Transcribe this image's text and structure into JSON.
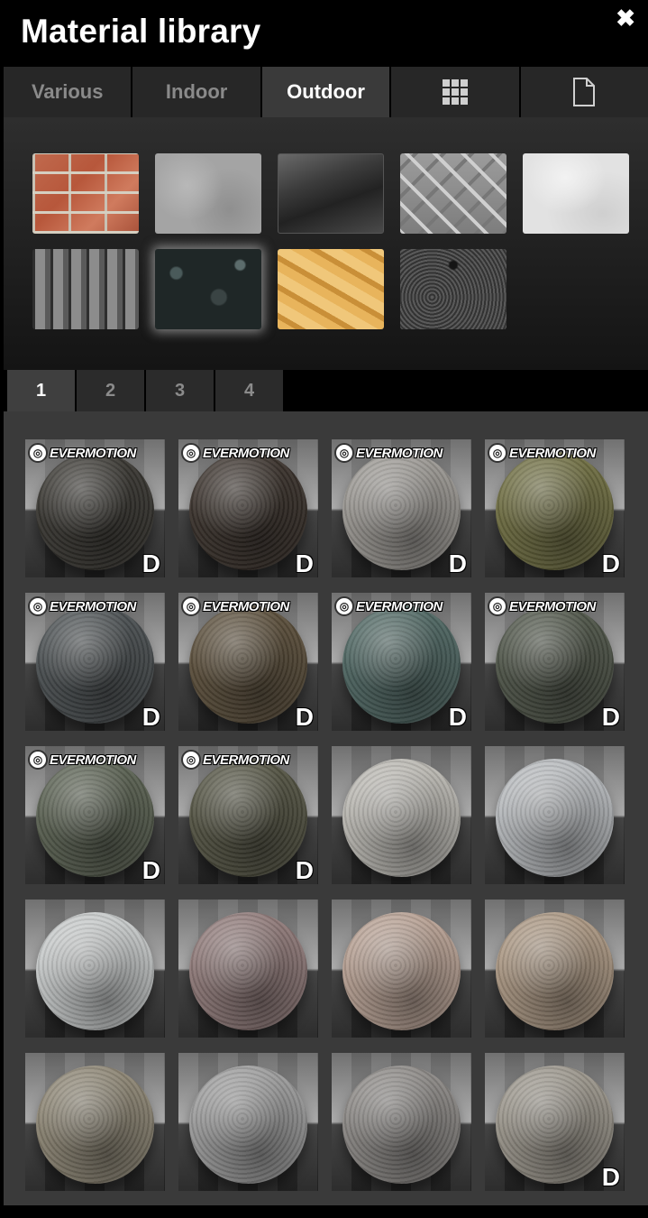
{
  "window": {
    "title": "Material library",
    "close_glyph": "✖"
  },
  "tabs": [
    {
      "label": "Various",
      "active": false
    },
    {
      "label": "Indoor",
      "active": false
    },
    {
      "label": "Outdoor",
      "active": true
    },
    {
      "label": "",
      "icon": "grid-icon",
      "active": false
    },
    {
      "label": "",
      "icon": "document-icon",
      "active": false
    }
  ],
  "categories": [
    {
      "name": "brick-swatch",
      "selected": false
    },
    {
      "name": "concrete-swatch",
      "selected": false
    },
    {
      "name": "glass-swatch",
      "selected": false
    },
    {
      "name": "diamond-plate-swatch",
      "selected": false
    },
    {
      "name": "plaster-swatch",
      "selected": false
    },
    {
      "name": "roof-tile-swatch",
      "selected": false
    },
    {
      "name": "granite-swatch",
      "selected": true
    },
    {
      "name": "osb-wood-swatch",
      "selected": false
    },
    {
      "name": "asphalt-swatch",
      "selected": false
    }
  ],
  "pagination": {
    "pages": [
      "1",
      "2",
      "3",
      "4"
    ],
    "active": "1"
  },
  "materials": [
    {
      "brand": "EVERMOTION",
      "download": "D",
      "color": "#3a3833"
    },
    {
      "brand": "EVERMOTION",
      "download": "D",
      "color": "#3b332d"
    },
    {
      "brand": "EVERMOTION",
      "download": "D",
      "color": "#9a9792"
    },
    {
      "brand": "EVERMOTION",
      "download": "D",
      "color": "#6f6e43"
    },
    {
      "brand": "EVERMOTION",
      "download": "D",
      "color": "#4b5052"
    },
    {
      "brand": "EVERMOTION",
      "download": "D",
      "color": "#5b4f3c"
    },
    {
      "brand": "EVERMOTION",
      "download": "D",
      "color": "#4f6662"
    },
    {
      "brand": "EVERMOTION",
      "download": "D",
      "color": "#4f5549"
    },
    {
      "brand": "EVERMOTION",
      "download": "D",
      "color": "#5a6152"
    },
    {
      "brand": "EVERMOTION",
      "download": "D",
      "color": "#545444"
    },
    {
      "brand": "",
      "download": "",
      "color": "#b9b7b1"
    },
    {
      "brand": "",
      "download": "",
      "color": "#b6b9bc"
    },
    {
      "brand": "",
      "download": "",
      "color": "#c5c8c8"
    },
    {
      "brand": "",
      "download": "",
      "color": "#8e7978"
    },
    {
      "brand": "",
      "download": "",
      "color": "#b59f92"
    },
    {
      "brand": "",
      "download": "",
      "color": "#a99682"
    },
    {
      "brand": "",
      "download": "",
      "color": "#8c8574"
    },
    {
      "brand": "",
      "download": "",
      "color": "#9b9b9b"
    },
    {
      "brand": "",
      "download": "",
      "color": "#8b8885"
    },
    {
      "brand": "",
      "download": "D",
      "color": "#9a958b"
    }
  ]
}
